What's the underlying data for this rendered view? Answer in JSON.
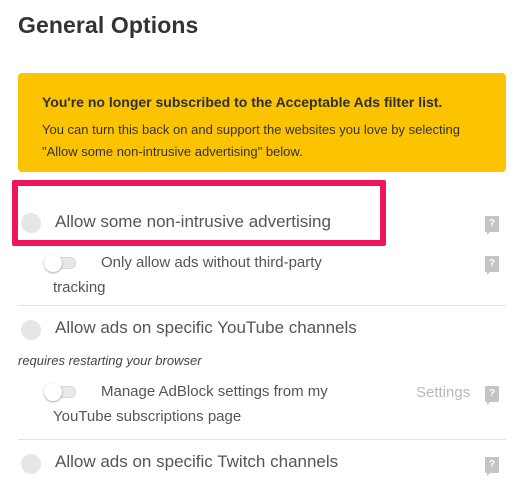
{
  "page": {
    "title": "General Options"
  },
  "notice": {
    "heading": "You're no longer subscribed to the Acceptable Ads filter list.",
    "body": "You can turn this back on and support the websites you love by selecting \"Allow some non-intrusive advertising\" below."
  },
  "options": {
    "acceptable_ads": {
      "label": "Allow some non-intrusive advertising",
      "help": "?"
    },
    "third_party": {
      "label": "Only allow ads without third-party tracking",
      "help": "?"
    },
    "youtube": {
      "label": "Allow ads on specific YouTube channels",
      "note": "requires restarting your browser"
    },
    "youtube_manage": {
      "label": "Manage AdBlock settings from my YouTube subscriptions page",
      "settings": "Settings",
      "help": "?"
    },
    "twitch": {
      "label": "Allow ads on specific Twitch channels",
      "help": "?"
    }
  },
  "colors": {
    "notice_bg": "#fcc400",
    "highlight": "#f0145a",
    "radio": "#e6e6e6",
    "help_icon": "#c4c4c4"
  },
  "icons": [
    "radio-button",
    "toggle-switch",
    "help-icon"
  ]
}
